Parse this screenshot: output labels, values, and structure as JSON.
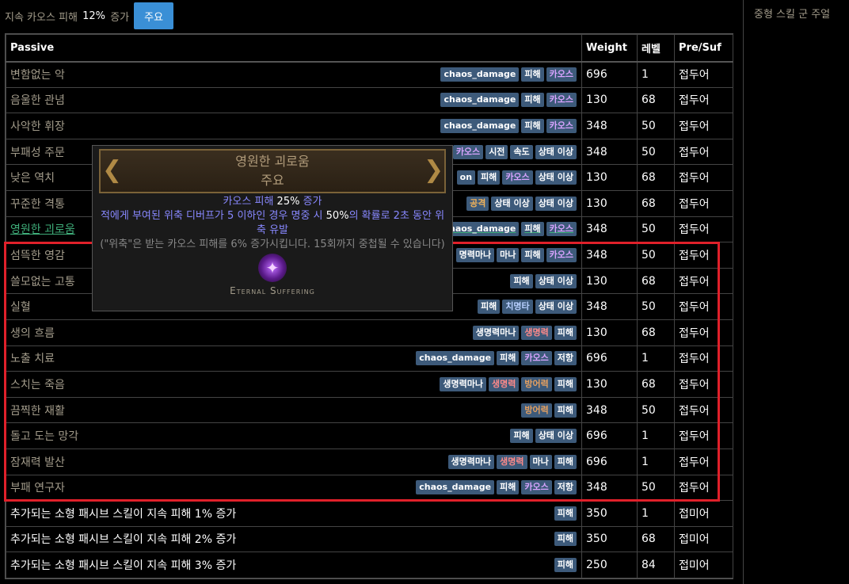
{
  "top_bar": {
    "text_prefix": "지속 카오스 피해",
    "text_value": "12%",
    "text_suffix": "증가",
    "major_button": "주요"
  },
  "sidebar": {
    "title": "중형 스킬 군 주얼"
  },
  "table": {
    "headers": [
      "Passive",
      "Weight",
      "레벨",
      "Pre/Suf"
    ],
    "rows": [
      {
        "name": "변함없는 악",
        "style": "",
        "tags": [
          [
            "chaos_damage",
            ""
          ],
          [
            "피해",
            ""
          ],
          [
            "카오스",
            "t-chaos"
          ]
        ],
        "weight": "696",
        "level": "1",
        "affix": "접두어"
      },
      {
        "name": "음울한 관념",
        "style": "",
        "tags": [
          [
            "chaos_damage",
            ""
          ],
          [
            "피해",
            ""
          ],
          [
            "카오스",
            "t-chaos"
          ]
        ],
        "weight": "130",
        "level": "68",
        "affix": "접두어"
      },
      {
        "name": "사악한 휘장",
        "style": "",
        "tags": [
          [
            "chaos_damage",
            ""
          ],
          [
            "피해",
            ""
          ],
          [
            "카오스",
            "t-chaos"
          ]
        ],
        "weight": "348",
        "level": "50",
        "affix": "접두어"
      },
      {
        "name": "부패성 주문",
        "style": "",
        "tags": [
          [
            "카오스",
            "t-chaos"
          ],
          [
            "시전",
            "t-cast"
          ],
          [
            "속도",
            "t-speed"
          ],
          [
            "상태 이상",
            ""
          ]
        ],
        "weight": "348",
        "level": "50",
        "affix": "접두어"
      },
      {
        "name": "낮은 역치",
        "style": "",
        "tags": [
          [
            "on",
            ""
          ],
          [
            "피해",
            ""
          ],
          [
            "카오스",
            "t-chaos"
          ],
          [
            "상태 이상",
            ""
          ]
        ],
        "weight": "130",
        "level": "68",
        "affix": "접두어"
      },
      {
        "name": "꾸준한 격통",
        "style": "",
        "tags": [
          [
            "공격",
            "t-attack"
          ],
          [
            "상태 이상",
            ""
          ],
          [
            "상태 이상",
            ""
          ]
        ],
        "weight": "130",
        "level": "68",
        "affix": "접두어"
      },
      {
        "name": "영원한 괴로움",
        "style": "link",
        "tags": [
          [
            "chaos_damage",
            ""
          ],
          [
            "피해",
            ""
          ],
          [
            "카오스",
            "t-chaos"
          ]
        ],
        "weight": "348",
        "level": "50",
        "affix": "접두어"
      },
      {
        "name": "섬뜩한 영감",
        "style": "",
        "tags": [
          [
            "명력마나",
            ""
          ],
          [
            "마나",
            ""
          ],
          [
            "피해",
            ""
          ],
          [
            "카오스",
            "t-chaos"
          ]
        ],
        "weight": "348",
        "level": "50",
        "affix": "접두어"
      },
      {
        "name": "쓸모없는 고통",
        "style": "",
        "tags": [
          [
            "피해",
            ""
          ],
          [
            "상태 이상",
            ""
          ]
        ],
        "weight": "130",
        "level": "68",
        "affix": "접두어"
      },
      {
        "name": "실혈",
        "style": "",
        "tags": [
          [
            "피해",
            ""
          ],
          [
            "치명타",
            "t-crit"
          ],
          [
            "상태 이상",
            ""
          ]
        ],
        "weight": "348",
        "level": "50",
        "affix": "접두어"
      },
      {
        "name": "생의 흐름",
        "style": "",
        "tags": [
          [
            "생명력마나",
            ""
          ],
          [
            "생명력",
            "t-life"
          ],
          [
            "피해",
            ""
          ]
        ],
        "weight": "130",
        "level": "68",
        "affix": "접두어"
      },
      {
        "name": "노출 치료",
        "style": "",
        "tags": [
          [
            "chaos_damage",
            ""
          ],
          [
            "피해",
            ""
          ],
          [
            "카오스",
            "t-chaos"
          ],
          [
            "저항",
            ""
          ]
        ],
        "weight": "696",
        "level": "1",
        "affix": "접두어"
      },
      {
        "name": "스치는 죽음",
        "style": "",
        "tags": [
          [
            "생명력마나",
            ""
          ],
          [
            "생명력",
            "t-life"
          ],
          [
            "방어력",
            "t-armour"
          ],
          [
            "피해",
            ""
          ]
        ],
        "weight": "130",
        "level": "68",
        "affix": "접두어"
      },
      {
        "name": "끔찍한 재활",
        "style": "",
        "tags": [
          [
            "방어력",
            "t-armour"
          ],
          [
            "피해",
            ""
          ]
        ],
        "weight": "348",
        "level": "50",
        "affix": "접두어"
      },
      {
        "name": "돌고 도는 망각",
        "style": "",
        "tags": [
          [
            "피해",
            ""
          ],
          [
            "상태 이상",
            ""
          ]
        ],
        "weight": "696",
        "level": "1",
        "affix": "접두어"
      },
      {
        "name": "잠재력 발산",
        "style": "",
        "tags": [
          [
            "생명력마나",
            ""
          ],
          [
            "생명력",
            "t-life"
          ],
          [
            "마나",
            ""
          ],
          [
            "피해",
            ""
          ]
        ],
        "weight": "696",
        "level": "1",
        "affix": "접두어"
      },
      {
        "name": "부패 연구자",
        "style": "",
        "tags": [
          [
            "chaos_damage",
            ""
          ],
          [
            "피해",
            ""
          ],
          [
            "카오스",
            "t-chaos"
          ],
          [
            "저항",
            ""
          ]
        ],
        "weight": "348",
        "level": "50",
        "affix": "접두어"
      },
      {
        "name": "추가되는 소형 패시브 스킬이 지속 피해 1% 증가",
        "style": "white",
        "tags": [
          [
            "피해",
            ""
          ]
        ],
        "weight": "350",
        "level": "1",
        "affix": "접미어"
      },
      {
        "name": "추가되는 소형 패시브 스킬이 지속 피해 2% 증가",
        "style": "white",
        "tags": [
          [
            "피해",
            ""
          ]
        ],
        "weight": "350",
        "level": "68",
        "affix": "접미어"
      },
      {
        "name": "추가되는 소형 패시브 스킬이 지속 피해 3% 증가",
        "style": "white",
        "tags": [
          [
            "피해",
            ""
          ]
        ],
        "weight": "250",
        "level": "84",
        "affix": "접미어"
      }
    ]
  },
  "tooltip": {
    "title": "영원한 괴로움",
    "subtitle": "주요",
    "mod1_prefix": "카오스 피해",
    "mod1_value": "25%",
    "mod1_suffix": "증가",
    "mod2_a": "적에게 부여된 위축 디버프가",
    "mod2_b": "5",
    "mod2_c": "이하인 경우 명중 시",
    "mod2_d": "50%",
    "mod2_e": "의 확률로 2초 동안 위축 유발",
    "reminder": "(\"위축\"은 받는 카오스 피해를 6% 증가시킵니다. 15회까지 중첩될 수 있습니다)",
    "icon": "eternal-suffering-icon",
    "caption": "Eternal Suffering"
  }
}
